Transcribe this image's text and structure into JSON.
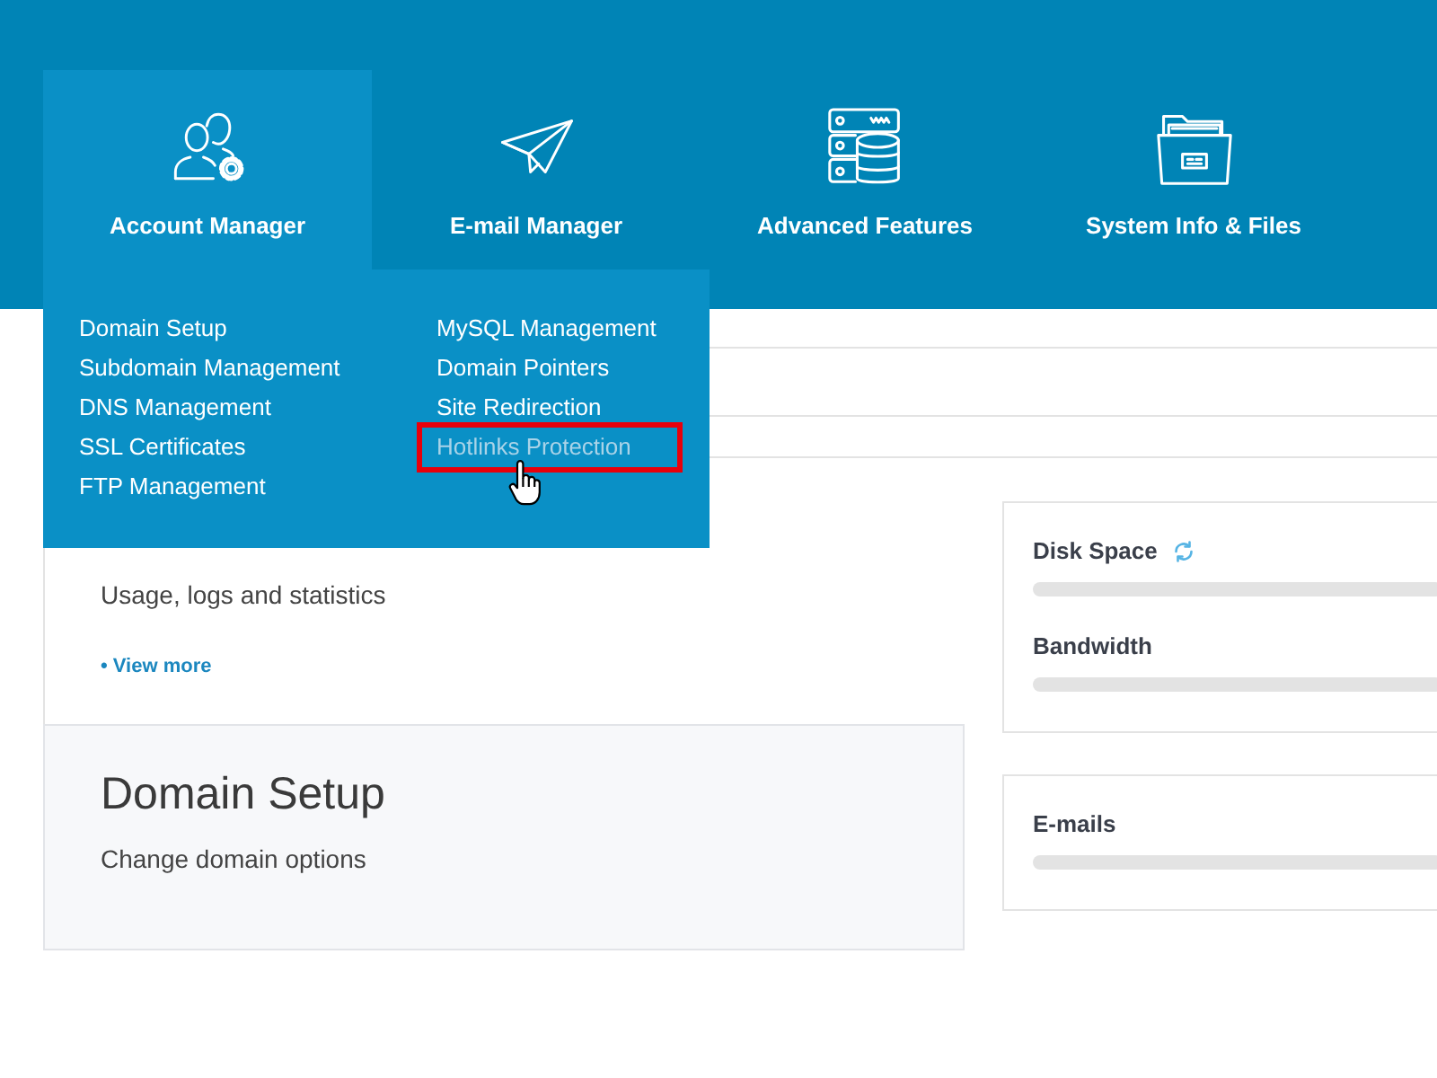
{
  "nav": {
    "tabs": [
      {
        "label": "Account Manager",
        "selected": true
      },
      {
        "label": "E-mail Manager",
        "selected": false
      },
      {
        "label": "Advanced Features",
        "selected": false
      },
      {
        "label": "System Info & Files",
        "selected": false
      }
    ]
  },
  "dropdown_menu": {
    "columns": [
      {
        "items": [
          {
            "label": "Domain Setup",
            "highlighted": false
          },
          {
            "label": "Subdomain Management",
            "highlighted": false
          },
          {
            "label": "DNS Management",
            "highlighted": false
          },
          {
            "label": "SSL Certificates",
            "highlighted": false
          },
          {
            "label": "FTP Management",
            "highlighted": false
          }
        ]
      },
      {
        "items": [
          {
            "label": "MySQL Management",
            "highlighted": false
          },
          {
            "label": "Domain Pointers",
            "highlighted": false
          },
          {
            "label": "Site Redirection",
            "highlighted": false
          },
          {
            "label": "Hotlinks Protection",
            "highlighted": true
          }
        ]
      }
    ]
  },
  "sections": [
    {
      "description": "Usage, logs and statistics",
      "link": "• View more",
      "highlighted": false
    },
    {
      "title": "Domain Setup",
      "description": "Change domain options",
      "highlighted": true
    }
  ],
  "usage_cards": [
    {
      "meters": [
        {
          "label": "Disk Space",
          "loading": true
        },
        {
          "label": "Bandwidth",
          "loading": false
        }
      ]
    },
    {
      "meters": [
        {
          "label": "E-mails",
          "loading": false
        }
      ]
    }
  ]
}
